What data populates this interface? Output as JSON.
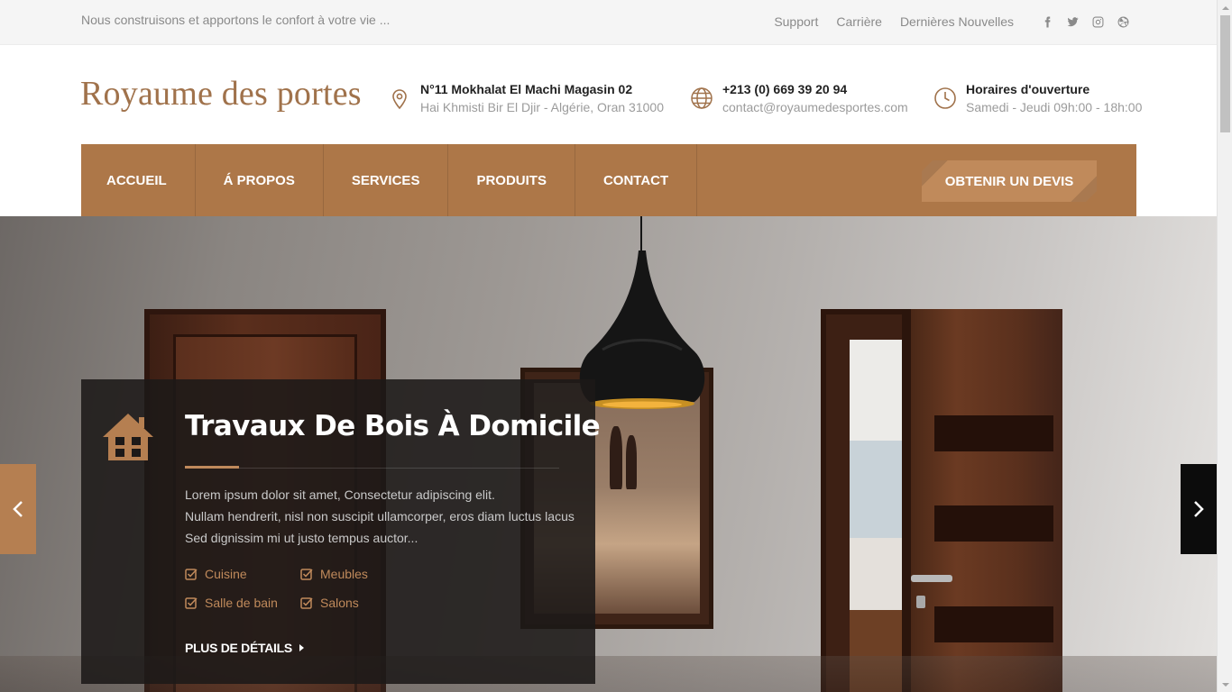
{
  "topbar": {
    "tagline": "Nous construisons et apportons le confort à votre vie ...",
    "links": [
      "Support",
      "Carrière",
      "Dernières Nouvelles"
    ],
    "social_icons": [
      "facebook-icon",
      "twitter-icon",
      "instagram-icon",
      "dribbble-icon"
    ]
  },
  "header": {
    "logo": "Royaume des portes",
    "address": {
      "line1": "N°11 Mokhalat El Machi Magasin 02",
      "line2": "Hai Khmisti Bir El Djir - Algérie, Oran 31000",
      "icon": "map-pin-icon"
    },
    "contact": {
      "line1": "+213 (0) 669 39 20 94",
      "line2": "contact@royaumedesportes.com",
      "icon": "globe-icon"
    },
    "hours": {
      "line1": "Horaires d'ouverture",
      "line2": "Samedi - Jeudi 09h:00 - 18h:00",
      "icon": "clock-icon"
    }
  },
  "nav": {
    "items": [
      "ACCUEIL",
      "Á PROPOS",
      "SERVICES",
      "PRODUITS",
      "CONTACT"
    ],
    "quote_button": "OBTENIR UN DEVIS"
  },
  "hero": {
    "title": "Travaux De Bois À Domicile",
    "description": "Lorem ipsum dolor sit amet, Consectetur adipiscing elit.\nNullam hendrerit, nisl non suscipit ullamcorper, eros diam luctus lacus\nSed dignissim mi ut justo tempus auctor...",
    "description_lines": [
      "Lorem ipsum dolor sit amet, Consectetur adipiscing elit.",
      "Nullam hendrerit, nisl non suscipit ullamcorper, eros diam luctus lacus",
      "Sed dignissim mi ut justo tempus auctor..."
    ],
    "features": [
      "Cuisine",
      "Meubles",
      "Salle de bain",
      "Salons"
    ],
    "more_link": "PLUS DE DÉTAILS",
    "icon": "house-icon"
  },
  "colors": {
    "accent": "#ad7748",
    "accent_light": "#c08a5b",
    "logo": "#a0724b",
    "overlay": "#1c1918"
  }
}
